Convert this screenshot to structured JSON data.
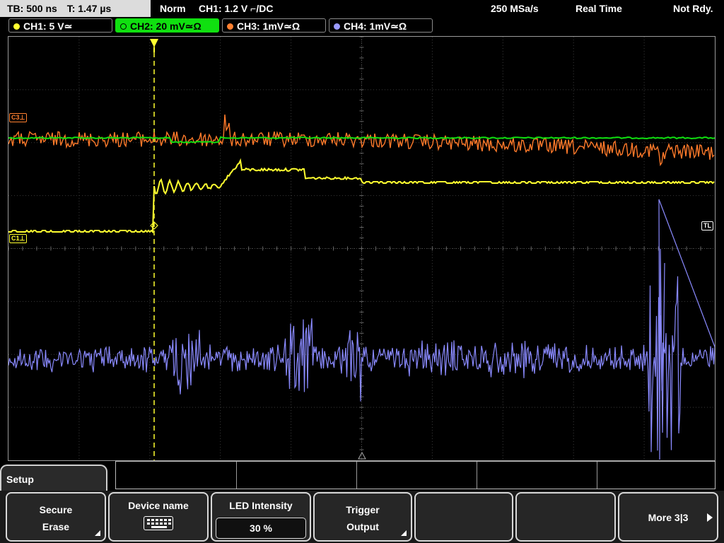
{
  "topbar": {
    "timebase": "TB: 500 ns",
    "trigger_time": "T: 1.47 µs",
    "mode": "Norm",
    "trigger_source": "CH1: 1.2 V ⌐/DC",
    "sample_rate": "250 MSa/s",
    "acq_mode": "Real Time",
    "status": "Not Rdy."
  },
  "channels": [
    {
      "label": "CH1: 5 V≃",
      "color": "#ffff30"
    },
    {
      "label": "CH2: 20 mV≃Ω",
      "color": "#10e010"
    },
    {
      "label": "CH3: 1mV≃Ω",
      "color": "#ff8030"
    },
    {
      "label": "CH4: 1mV≃Ω",
      "color": "#9a9aff"
    }
  ],
  "markers": {
    "c3": "C3⊥",
    "c1": "C1⊥",
    "tl": "TL"
  },
  "menu": {
    "title": "Setup",
    "softkeys": {
      "secure_erase_1": "Secure",
      "secure_erase_2": "Erase",
      "device_name": "Device name",
      "led_label": "LED Intensity",
      "led_value": "30 %",
      "trigger_output_1": "Trigger",
      "trigger_output_2": "Output",
      "more": "More 3|3"
    }
  }
}
